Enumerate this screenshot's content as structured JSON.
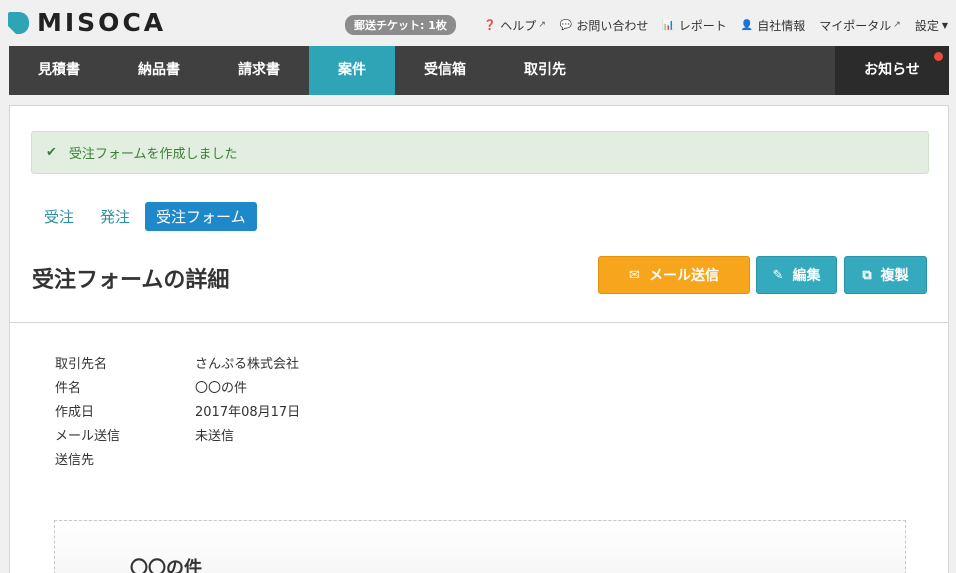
{
  "app": {
    "logo_text": "MISOCA"
  },
  "toplinks": {
    "ticket": "郵送チケット: 1枚",
    "help": "ヘルプ",
    "contact": "お問い合わせ",
    "report": "レポート",
    "company": "自社情報",
    "myportal": "マイポータル",
    "settings": "設定"
  },
  "nav": {
    "items": [
      {
        "label": "見積書"
      },
      {
        "label": "納品書"
      },
      {
        "label": "請求書"
      },
      {
        "label": "案件"
      },
      {
        "label": "受信箱"
      },
      {
        "label": "取引先"
      }
    ],
    "active_index": 3,
    "notice": "お知らせ"
  },
  "alert": {
    "message": "受注フォームを作成しました"
  },
  "subtabs": [
    {
      "label": "受注"
    },
    {
      "label": "発注"
    },
    {
      "label": "受注フォーム"
    }
  ],
  "page": {
    "title": "受注フォームの詳細"
  },
  "buttons": {
    "mail": "メール送信",
    "edit": "編集",
    "copy": "複製"
  },
  "details": [
    {
      "label": "取引先名",
      "value": "さんぷる株式会社"
    },
    {
      "label": "件名",
      "value": "〇〇の件"
    },
    {
      "label": "作成日",
      "value": "2017年08月17日"
    },
    {
      "label": "メール送信",
      "value": "未送信"
    },
    {
      "label": "送信先",
      "value": ""
    }
  ],
  "preview": {
    "title": "〇〇の件"
  },
  "colors": {
    "accent": "#2fa4b7",
    "nav_bg": "#404040",
    "mail_button": "#f7a51c",
    "active_subtab": "#1e88c8",
    "notice_dot": "#e74c3c"
  }
}
